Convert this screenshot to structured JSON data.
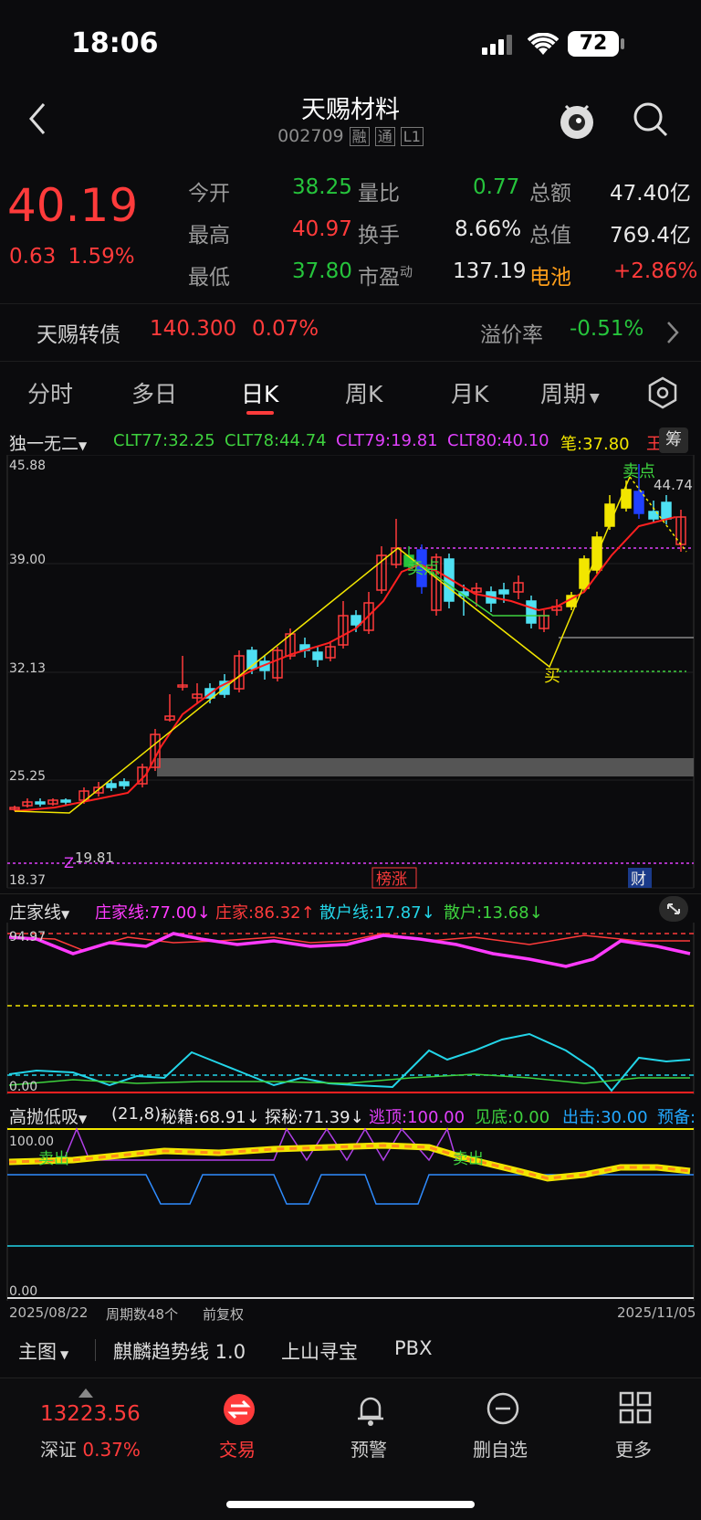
{
  "status": {
    "time": "18:06",
    "battery": "72"
  },
  "header": {
    "title": "天赐材料",
    "code": "002709",
    "tag1": "融",
    "tag2": "通",
    "tag3": "L1"
  },
  "quote": {
    "price": "40.19",
    "change": "0.63",
    "change_pct": "1.59%",
    "rows": [
      {
        "l1": "今开",
        "v1": "38.25",
        "l2": "量比",
        "v2": "0.77",
        "l3": "总额",
        "v3": "47.40亿"
      },
      {
        "l1": "最高",
        "v1": "40.97",
        "l2": "换手",
        "v2": "8.66%",
        "l3": "总值",
        "v3": "769.4亿"
      },
      {
        "l1": "最低",
        "v1": "37.80",
        "l2": "市盈",
        "l2sup": "动",
        "v2": "137.19",
        "l3": "电池",
        "v3": "+2.86%"
      }
    ]
  },
  "bond": {
    "name": "天赐转债",
    "price": "140.300",
    "pct": "0.07%",
    "premium_label": "溢价率",
    "premium": "-0.51%"
  },
  "tabs": [
    "分时",
    "多日",
    "日K",
    "周K",
    "月K",
    "周期"
  ],
  "main_chart": {
    "indicator": "独一无二",
    "legend": [
      {
        "text": "CLT77:32.25",
        "color": "#3ed23e"
      },
      {
        "text": "CLT78:44.74",
        "color": "#3ed23e"
      },
      {
        "text": "CLT79:19.81",
        "color": "#e040fb"
      },
      {
        "text": "CLT80:40.10",
        "color": "#e040fb"
      },
      {
        "text": "笔:37.80",
        "color": "#f2e600"
      }
    ],
    "legend_tail": "王",
    "chip_label": "筹",
    "y_labels": [
      "45.88",
      "39.00",
      "32.13",
      "25.25",
      "18.37"
    ],
    "annotations": {
      "sell1": "卖点",
      "sell2": "卖点",
      "buy": "买",
      "z": "Z",
      "low": "19.81",
      "high": "44.74",
      "bang": "榜涨",
      "cai": "财"
    }
  },
  "sub1": {
    "name": "庄家线",
    "legend": [
      {
        "text": "庄家线:77.00↓",
        "color": "#ff3bff"
      },
      {
        "text": "庄家:86.32↑",
        "color": "#ff3b3b"
      },
      {
        "text": "散户线:17.87↓",
        "color": "#23d5e8"
      },
      {
        "text": "散户:13.68↓",
        "color": "#3ed23e"
      }
    ],
    "top": "94.97",
    "bottom": "0.00"
  },
  "sub2": {
    "name": "高抛低吸",
    "legend": [
      {
        "text": "(21,8)",
        "color": "#e9e9e9"
      },
      {
        "text": "秘籍:68.91↓",
        "color": "#e9e9e9"
      },
      {
        "text": "探秘:71.39↓",
        "color": "#e9e9e9"
      },
      {
        "text": "逃顶:100.00",
        "color": "#e040fb"
      },
      {
        "text": "见底:0.00",
        "color": "#3ed23e"
      },
      {
        "text": "出击:30.00",
        "color": "#23a8ff"
      },
      {
        "text": "预备:",
        "color": "#23a8ff"
      }
    ],
    "top": "100.00",
    "bottom": "0.00",
    "sell1": "卖出",
    "sell2": "卖出"
  },
  "date_bar": {
    "start": "2025/08/22",
    "cycles": "周期数48个",
    "adj": "前复权",
    "end": "2025/11/05"
  },
  "indicator_bar": {
    "main": "主图",
    "items": [
      "麒麟趋势线 1.0",
      "上山寻宝",
      "PBX"
    ]
  },
  "bottom_nav": {
    "index_value": "13223.56",
    "index_name": "深证",
    "index_pct": "0.37%",
    "items": [
      "交易",
      "预警",
      "删自选",
      "更多"
    ]
  },
  "colors": {
    "up": "#ff3b3b",
    "down": "#26c43c",
    "accent": "#ff9f1a",
    "bg": "#0b0b0d"
  }
}
